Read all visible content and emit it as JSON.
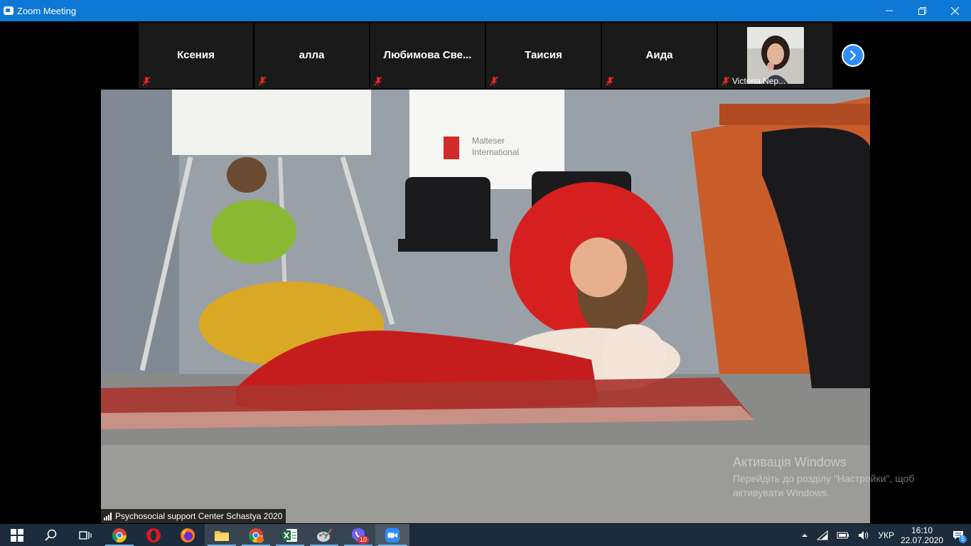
{
  "window": {
    "title": "Zoom Meeting",
    "controls": {
      "minimize": "—",
      "restore": "❐",
      "close": "✕"
    }
  },
  "participants": [
    {
      "name": "Ксения",
      "muted": true
    },
    {
      "name": "алла",
      "muted": true
    },
    {
      "name": "Любимова  Све...",
      "muted": true
    },
    {
      "name": "Таисия",
      "muted": true
    },
    {
      "name": "Аида",
      "muted": true
    },
    {
      "name": "Victoria Nep...",
      "muted": true,
      "has_video": true
    }
  ],
  "next_page_icon": "chevron-right-icon",
  "main_video": {
    "speaker_name": "Psychosocial support Center Schastya 2020",
    "banner_text": "Malteser International"
  },
  "watermark": {
    "line1": "Активація Windows",
    "line2": "Перейдіть до розділу \"Настройки\", щоб",
    "line3": "активувати Windows."
  },
  "taskbar": {
    "apps": [
      {
        "name": "start",
        "icon": "windows-logo-icon"
      },
      {
        "name": "search",
        "icon": "search-icon"
      },
      {
        "name": "task-view",
        "icon": "task-view-icon"
      },
      {
        "name": "chrome",
        "icon": "chrome-icon"
      },
      {
        "name": "opera",
        "icon": "opera-icon"
      },
      {
        "name": "firefox",
        "icon": "firefox-icon"
      },
      {
        "name": "file-explorer",
        "icon": "folder-icon"
      },
      {
        "name": "chrome-profile",
        "icon": "chrome-icon"
      },
      {
        "name": "excel",
        "icon": "excel-icon"
      },
      {
        "name": "paint",
        "icon": "paint-icon"
      },
      {
        "name": "viber",
        "icon": "viber-icon",
        "badge": "10"
      },
      {
        "name": "zoom",
        "icon": "zoom-icon"
      }
    ],
    "tray": {
      "language": "УКР",
      "time": "16:10",
      "date": "22.07.2020",
      "notifications": "5"
    }
  },
  "colors": {
    "titlebar": "#0d78d6",
    "taskbar": "#1c2c3c",
    "zoom_blue": "#2d8cff",
    "mute_red": "#e02828"
  }
}
